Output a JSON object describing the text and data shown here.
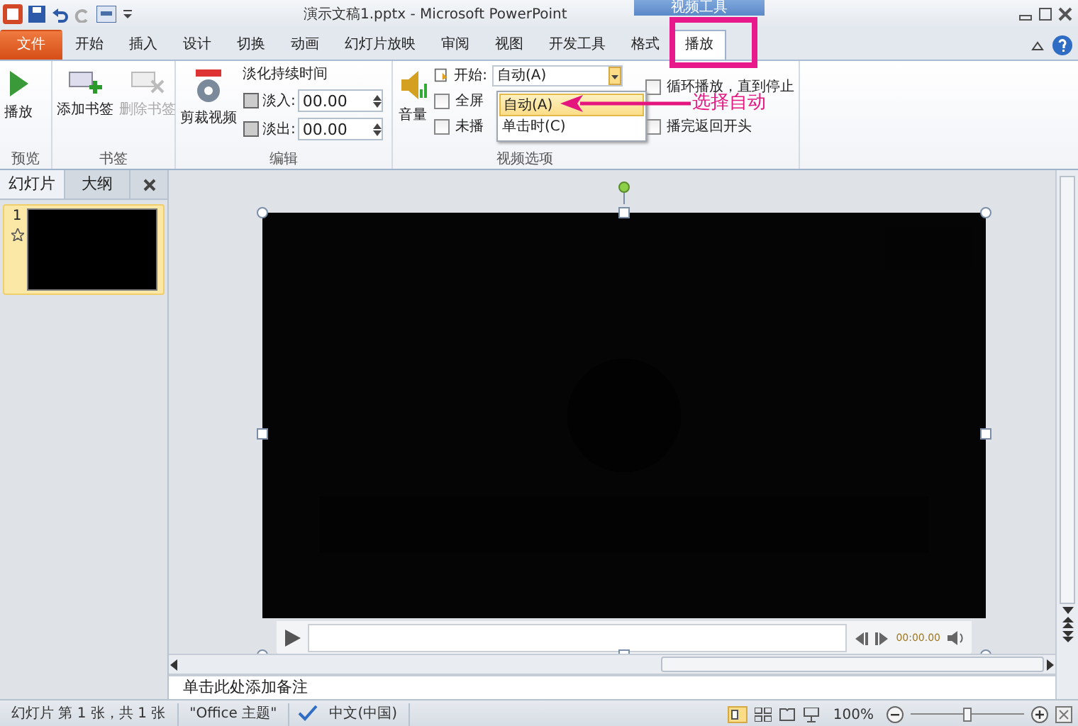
{
  "title_bar": {
    "title": "演示文稿1.pptx - Microsoft PowerPoint",
    "context_label": "视频工具"
  },
  "tabs": [
    {
      "label": "文件",
      "kind": "file",
      "selected": false
    },
    {
      "label": "开始",
      "kind": "normal",
      "selected": false
    },
    {
      "label": "插入",
      "kind": "normal",
      "selected": false
    },
    {
      "label": "设计",
      "kind": "normal",
      "selected": false
    },
    {
      "label": "切换",
      "kind": "normal",
      "selected": false
    },
    {
      "label": "动画",
      "kind": "normal",
      "selected": false
    },
    {
      "label": "幻灯片放映",
      "kind": "normal",
      "selected": false
    },
    {
      "label": "审阅",
      "kind": "normal",
      "selected": false
    },
    {
      "label": "视图",
      "kind": "normal",
      "selected": false
    },
    {
      "label": "开发工具",
      "kind": "normal",
      "selected": false
    },
    {
      "label": "格式",
      "kind": "context",
      "selected": false
    },
    {
      "label": "播放",
      "kind": "context",
      "selected": true
    }
  ],
  "ribbon": {
    "preview": {
      "title": "预览",
      "play": "播放"
    },
    "bookmarks": {
      "title": "书签",
      "add": {
        "label": "添加书签",
        "disabled": false
      },
      "remove": {
        "label": "删除书签",
        "disabled": true
      }
    },
    "editing": {
      "title": "编辑",
      "trim": "剪裁视频",
      "fade_title": "淡化持续时间",
      "fade_in_label": "淡入:",
      "fade_in_value": "00.00",
      "fade_out_label": "淡出:",
      "fade_out_value": "00.00"
    },
    "video_options": {
      "title": "视频选项",
      "volume": "音量",
      "start_label": "开始:",
      "start_value": "自动(A)",
      "options_left": [
        {
          "label": "全屏",
          "checked": false
        },
        {
          "label": "未播",
          "checked": false
        }
      ],
      "options_right": [
        {
          "label": "循环播放，直到停止",
          "checked": false
        },
        {
          "label": "播完返回开头",
          "checked": false
        }
      ],
      "dropdown": [
        {
          "label": "自动(A)",
          "selected": true
        },
        {
          "label": "单击时(C)",
          "selected": false
        }
      ]
    }
  },
  "annotation": {
    "text": "选择自动"
  },
  "slides_panel": {
    "tabs": [
      {
        "label": "幻灯片",
        "selected": true
      },
      {
        "label": "大纲",
        "selected": false
      }
    ],
    "slides": [
      {
        "number": "1",
        "selected": true
      }
    ]
  },
  "video": {
    "time": "00:00.00"
  },
  "notes": {
    "placeholder": "单击此处添加备注"
  },
  "status_bar": {
    "items": [
      "幻灯片 第 1 张，共 1 张",
      "\"Office 主题\"",
      "中文(中国)"
    ],
    "zoom": "100%",
    "zoom_slider": {
      "level": 0.5
    }
  }
}
